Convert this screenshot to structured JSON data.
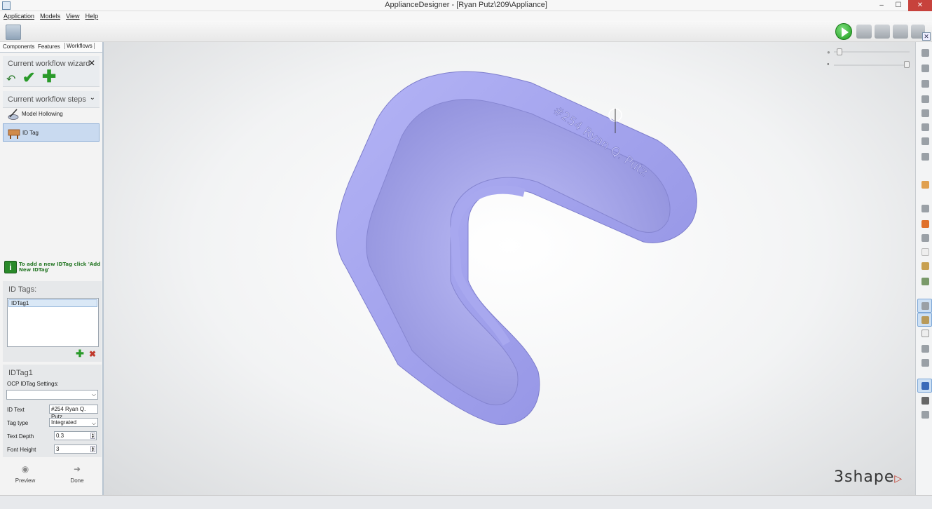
{
  "window": {
    "title": "ApplianceDesigner - [Ryan Putz\\209\\Appliance]",
    "minimize": "‒",
    "maximize": "☐",
    "close": "✕"
  },
  "menu": [
    "Application",
    "Models",
    "View",
    "Help"
  ],
  "toolbar": {
    "close_label": "✕"
  },
  "panel_tabs": [
    "Components",
    "Features",
    "Workflows"
  ],
  "wizard": {
    "title": "Current workflow wizard",
    "close": "✕",
    "back": "↶",
    "accept": "✔",
    "add": "✚"
  },
  "steps": {
    "title": "Current workflow steps",
    "items": [
      {
        "label": "Model Hollowing"
      },
      {
        "label": "ID Tag"
      }
    ]
  },
  "hint": "To add a new IDTag click 'Add New IDTag'",
  "id_tags": {
    "title": "ID Tags:",
    "items": [
      "IDTag1"
    ],
    "add": "✚",
    "delete": "✖"
  },
  "idtag_settings": {
    "title": "IDTag1",
    "ocp_label": "OCP IDTag Settings:",
    "ocp_value": "",
    "id_text_label": "ID Text",
    "id_text_value": "#254 Ryan Q. Putz",
    "tag_type_label": "Tag type",
    "tag_type_value": "Integrated",
    "text_depth_label": "Text Depth",
    "text_depth_value": "0.3",
    "font_height_label": "Font Height",
    "font_height_value": "3"
  },
  "bottom": {
    "preview": "Preview",
    "done": "Done"
  },
  "viewport": {
    "engraved_text": "#254 Ryan Q. Putz",
    "model_color": "#a3a3ee",
    "logo": "3shape"
  }
}
